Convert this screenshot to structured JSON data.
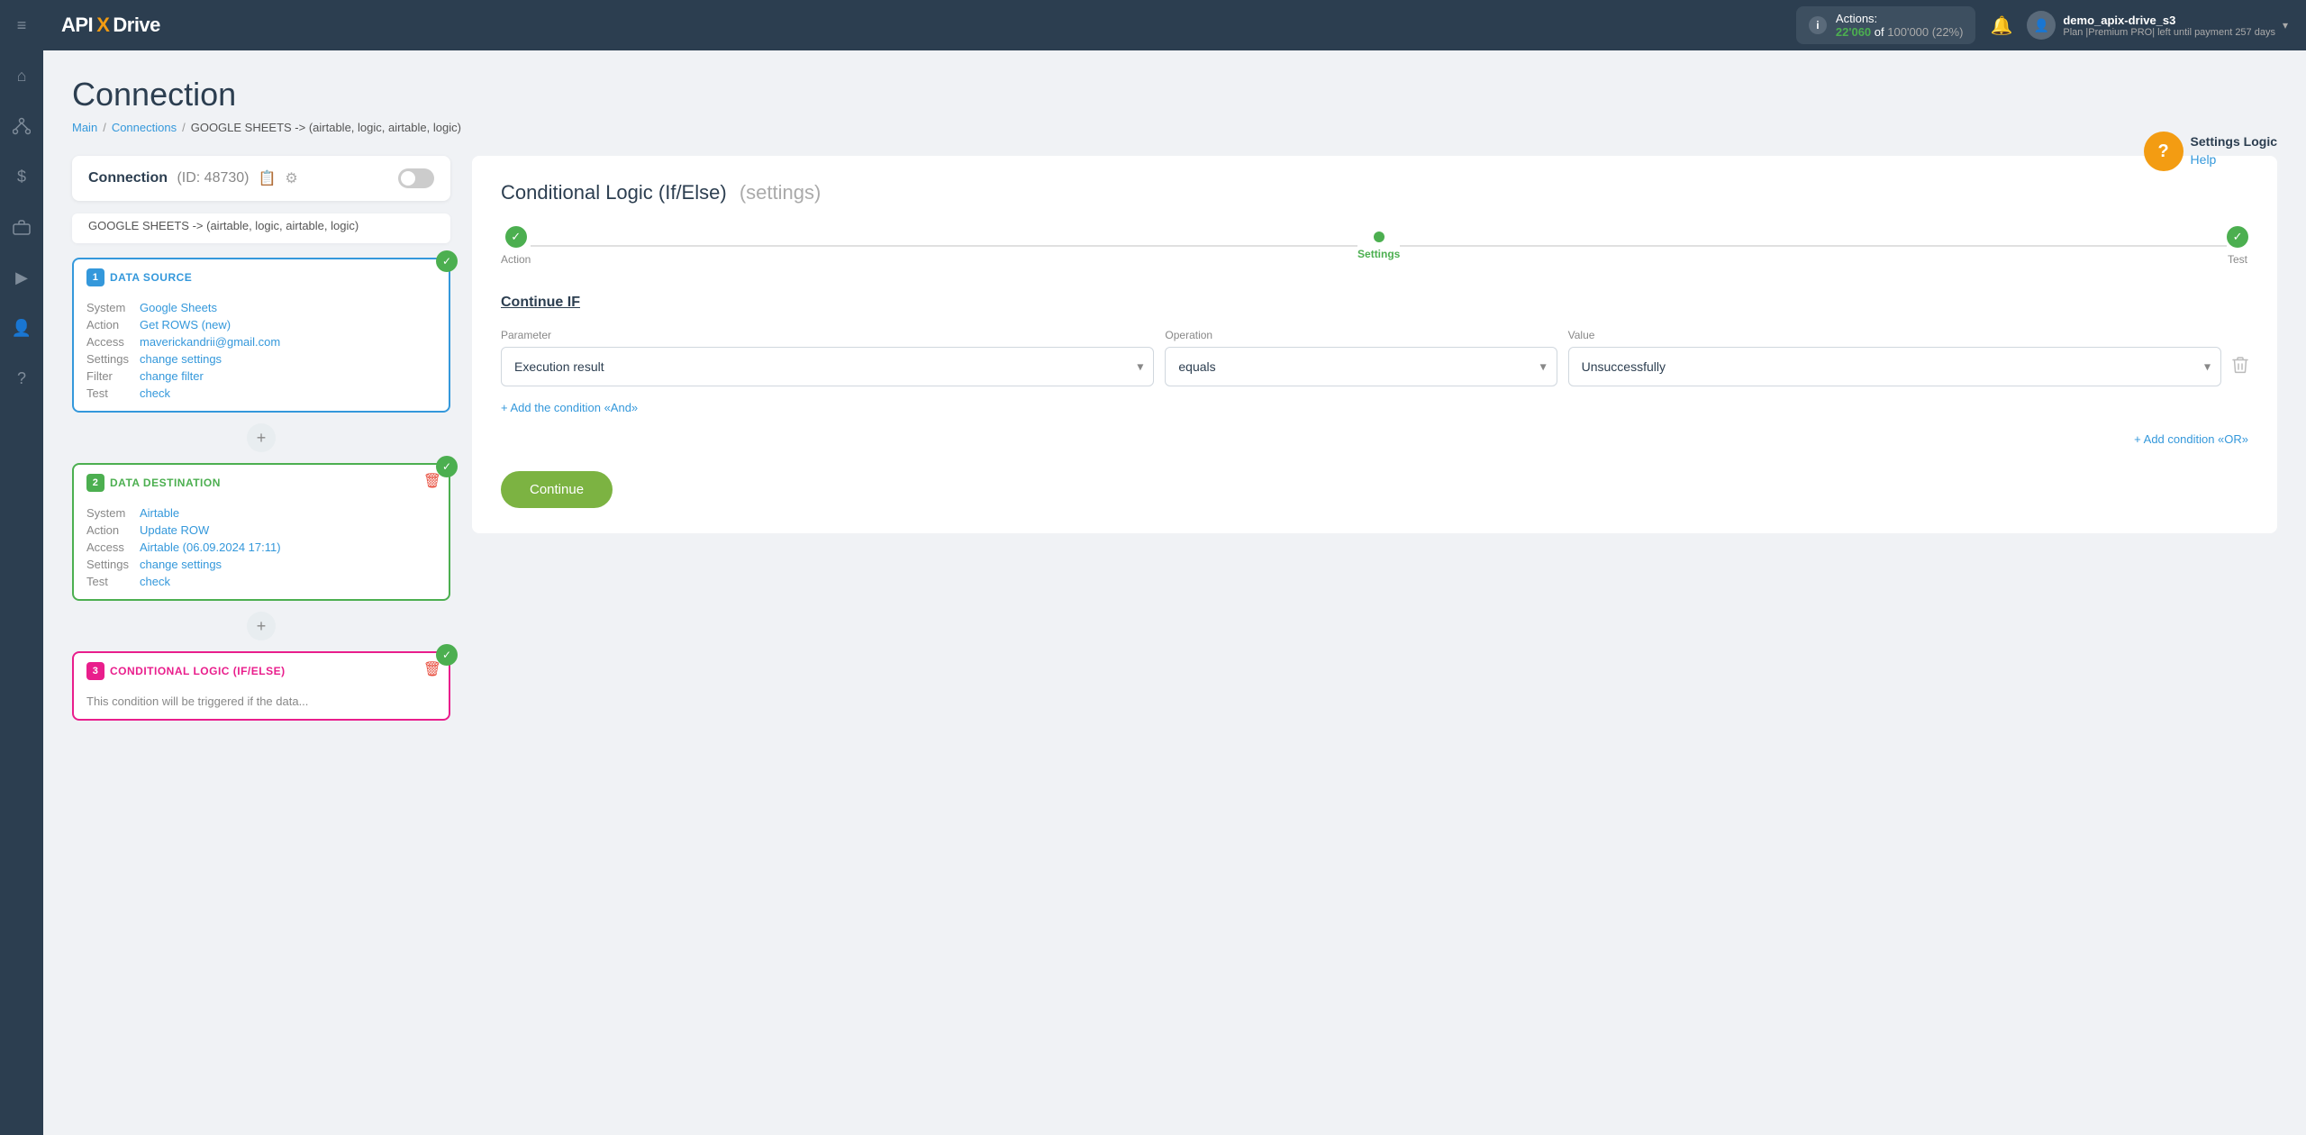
{
  "topnav": {
    "logo": {
      "api": "API",
      "x": "X",
      "drive": "Drive"
    },
    "actions": {
      "label": "Actions:",
      "count": "22'060",
      "of": "of",
      "total": "100'000",
      "pct": "(22%)"
    },
    "user": {
      "name": "demo_apix-drive_s3",
      "plan": "Plan |Premium PRO| left until payment 257 days"
    }
  },
  "sidebar": {
    "icons": [
      "≡",
      "⌂",
      "⚙",
      "$",
      "📁",
      "▶",
      "👤",
      "?"
    ]
  },
  "page": {
    "title": "Connection",
    "breadcrumb": {
      "main": "Main",
      "connections": "Connections",
      "current": "GOOGLE SHEETS -> (airtable, logic, airtable, logic)"
    }
  },
  "help": {
    "settings_logic": "Settings Logic",
    "help": "Help"
  },
  "connection_panel": {
    "title": "Connection",
    "id": "(ID: 48730)",
    "subtitle": "GOOGLE SHEETS -> (airtable, logic, airtable, logic)"
  },
  "data_source": {
    "number": "1",
    "label": "DATA SOURCE",
    "rows": [
      {
        "label": "System",
        "value": "Google Sheets",
        "link": true
      },
      {
        "label": "Action",
        "value": "Get ROWS (new)",
        "link": true
      },
      {
        "label": "Access",
        "value": "maverickandrii@gmail.com",
        "link": true
      },
      {
        "label": "Settings",
        "value": "change settings",
        "link": true
      },
      {
        "label": "Filter",
        "value": "change filter",
        "link": true
      },
      {
        "label": "Test",
        "value": "check",
        "link": true
      }
    ]
  },
  "data_destination": {
    "number": "2",
    "label": "DATA DESTINATION",
    "rows": [
      {
        "label": "System",
        "value": "Airtable",
        "link": true
      },
      {
        "label": "Action",
        "value": "Update ROW",
        "link": true
      },
      {
        "label": "Access",
        "value": "Airtable (06.09.2024 17:11)",
        "link": true
      },
      {
        "label": "Settings",
        "value": "change settings",
        "link": true
      },
      {
        "label": "Test",
        "value": "check",
        "link": true
      }
    ]
  },
  "conditional_logic": {
    "number": "3",
    "label": "CONDITIONAL LOGIC (IF/ELSE)",
    "subtitle": "This condition will be triggered if the data..."
  },
  "main_panel": {
    "title": "Conditional Logic (If/Else)",
    "settings_label": "(settings)",
    "steps": [
      {
        "label": "Action",
        "state": "done"
      },
      {
        "label": "Settings",
        "state": "active"
      },
      {
        "label": "Test",
        "state": "done"
      }
    ],
    "continue_if_title": "Continue IF",
    "condition": {
      "parameter_label": "Parameter",
      "parameter_value": "Execution result",
      "operation_label": "Operation",
      "operation_value": "equals",
      "value_label": "Value",
      "value_value": "Unsuccessfully"
    },
    "add_condition_label": "+ Add the condition «And»",
    "add_or_label": "+ Add condition «OR»",
    "continue_button": "Continue"
  }
}
